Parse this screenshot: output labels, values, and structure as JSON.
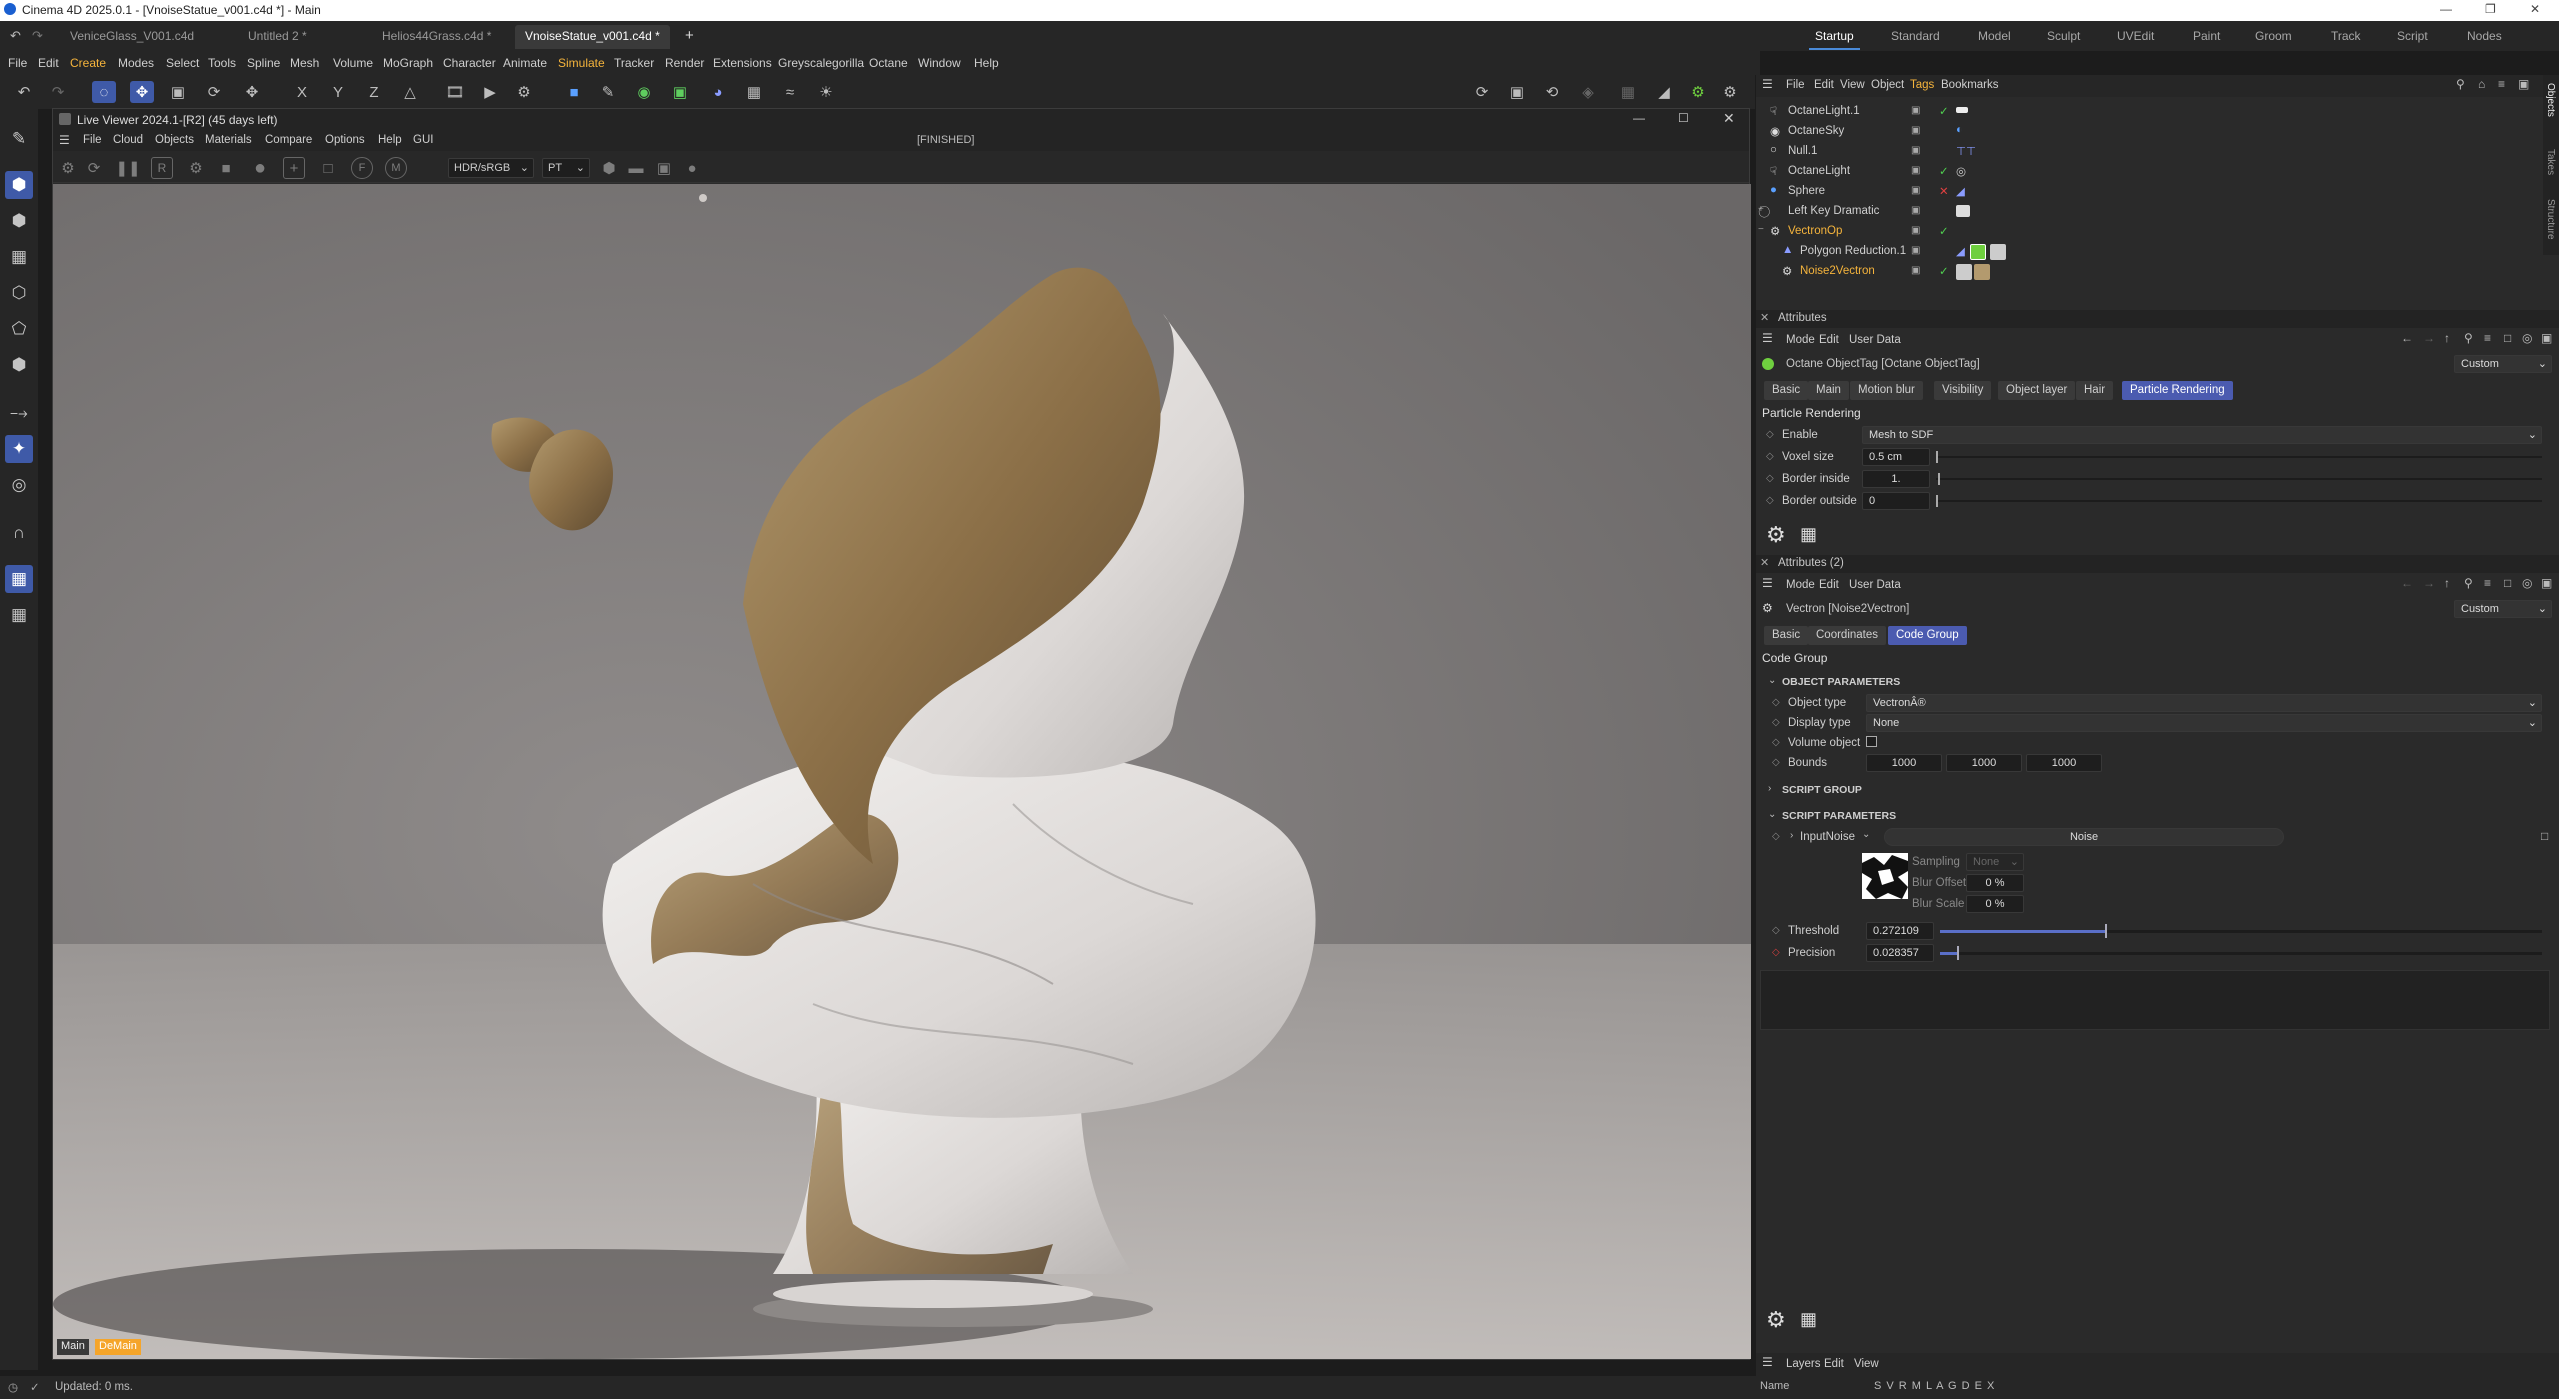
{
  "window": {
    "title": "Cinema 4D 2025.0.1 - [VnoiseStatue_v001.c4d *] - Main"
  },
  "tabs": {
    "docs": [
      "VeniceGlass_V001.c4d",
      "Untitled 2 *",
      "Helios44Grass.c4d *",
      "VnoiseStatue_v001.c4d *"
    ],
    "add": "+",
    "layouts": [
      "Startup",
      "Standard",
      "Model",
      "Sculpt",
      "UVEdit",
      "Paint",
      "Groom",
      "Track",
      "Script",
      "Nodes"
    ]
  },
  "menu": [
    "File",
    "Edit",
    "Create",
    "Modes",
    "Select",
    "Tools",
    "Spline",
    "Mesh",
    "Volume",
    "MoGraph",
    "Character",
    "Animate",
    "Simulate",
    "Tracker",
    "Render",
    "Extensions",
    "Greyscalegorilla",
    "Octane",
    "Window",
    "Help"
  ],
  "toolbar": {
    "axis": [
      "X",
      "Y",
      "Z"
    ]
  },
  "live_viewer": {
    "title": "Live Viewer 2024.1-[R2] (45 days left)",
    "menu": [
      "File",
      "Cloud",
      "Objects",
      "Materials",
      "Compare",
      "Options",
      "Help",
      "GUI"
    ],
    "status": "[FINISHED]",
    "color_space": "HDR/sRGB",
    "kernel": "PT",
    "r_button": "R",
    "m_button": "M",
    "f_button": "F",
    "footer_tabs": [
      "Main",
      "DeMain"
    ]
  },
  "objects": {
    "menu": [
      "File",
      "Edit",
      "View",
      "Object",
      "Tags",
      "Bookmarks"
    ],
    "items": [
      {
        "name": "OctaneLight.1",
        "icon": "light-icon",
        "selected": false
      },
      {
        "name": "OctaneSky",
        "icon": "sky-icon",
        "selected": false
      },
      {
        "name": "Null.1",
        "icon": "null-icon",
        "selected": false
      },
      {
        "name": "OctaneLight",
        "icon": "light-icon",
        "selected": false
      },
      {
        "name": "Sphere",
        "icon": "sphere-icon",
        "selected": false
      },
      {
        "name": "Left Key Dramatic",
        "icon": "null-icon",
        "selected": false
      },
      {
        "name": "VectronOp",
        "icon": "vectron-icon",
        "selected": true
      },
      {
        "name": "Polygon Reduction.1",
        "icon": "polygon-reduction-icon",
        "selected": false
      },
      {
        "name": "Noise2Vectron",
        "icon": "vectron-icon",
        "selected": true
      }
    ],
    "side_tabs": [
      "Objects",
      "Takes",
      "Structure"
    ]
  },
  "attributes1": {
    "title": "Attributes",
    "menu": [
      "Mode",
      "Edit",
      "User Data"
    ],
    "object": "Octane ObjectTag [Octane ObjectTag]",
    "preset": "Custom",
    "tabs": [
      "Basic",
      "Main",
      "Motion blur",
      "Visibility",
      "Object layer",
      "Hair",
      "Particle Rendering"
    ],
    "section": "Particle Rendering",
    "params": [
      {
        "label": "Enable",
        "value": "Mesh to SDF"
      },
      {
        "label": "Voxel size",
        "value": "0.5 cm"
      },
      {
        "label": "Border inside",
        "value": "1."
      },
      {
        "label": "Border outside",
        "value": "0"
      }
    ]
  },
  "attributes2": {
    "title": "Attributes (2)",
    "menu": [
      "Mode",
      "Edit",
      "User Data"
    ],
    "object": "Vectron [Noise2Vectron]",
    "preset": "Custom",
    "tabs": [
      "Basic",
      "Coordinates",
      "Code Group"
    ],
    "section": "Code Group",
    "object_parameters": "OBJECT PARAMETERS",
    "object_type_label": "Object type",
    "object_type": "VectronÂ®",
    "display_type_label": "Display type",
    "display_type": "None",
    "volume_object_label": "Volume object",
    "bounds_label": "Bounds",
    "bounds": [
      "1000",
      "1000",
      "1000"
    ],
    "script_group": "SCRIPT GROUP",
    "script_parameters": "SCRIPT PARAMETERS",
    "input_noise_label": "InputNoise",
    "input_noise_value": "Noise",
    "sampling_label": "Sampling",
    "sampling_value": "None",
    "blur_offset_label": "Blur Offset",
    "blur_offset": "0 %",
    "blur_scale_label": "Blur Scale",
    "blur_scale": "0 %",
    "threshold_label": "Threshold",
    "threshold": "0.272109",
    "precision_label": "Precision",
    "precision": "0.028357"
  },
  "layers": {
    "menu": [
      "Layers",
      "Edit",
      "View"
    ],
    "name_col": "Name",
    "flags": "S V R M L A G D E X"
  },
  "status": {
    "text": "Updated: 0 ms."
  },
  "colors": {
    "accent": "#4b5bb0",
    "highlight": "#f5b43c",
    "panel": "#2a2a2a"
  }
}
